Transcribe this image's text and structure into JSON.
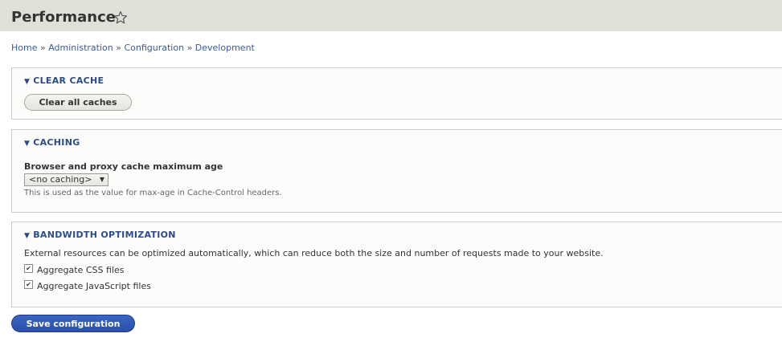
{
  "header": {
    "title": "Performance",
    "star_icon": "star-outline-icon"
  },
  "breadcrumb": {
    "items": [
      "Home",
      "Administration",
      "Configuration",
      "Development"
    ],
    "separator": "»"
  },
  "clear_cache": {
    "legend": "CLEAR CACHE",
    "button_label": "Clear all caches"
  },
  "caching": {
    "legend": "CACHING",
    "field_label": "Browser and proxy cache maximum age",
    "selected_value": "<no caching>",
    "help_text": "This is used as the value for max-age in Cache-Control headers."
  },
  "bandwidth": {
    "legend": "BANDWIDTH OPTIMIZATION",
    "description": "External resources can be optimized automatically, which can reduce both the size and number of requests made to your website.",
    "checkboxes": [
      {
        "label": "Aggregate CSS files",
        "checked": true
      },
      {
        "label": "Aggregate JavaScript files",
        "checked": true
      }
    ]
  },
  "actions": {
    "save_label": "Save configuration"
  },
  "colors": {
    "header_bg": "#e0e0d8",
    "link": "#3a5a9b",
    "legend": "#2d4a8a",
    "primary_button": "#2950a8"
  }
}
